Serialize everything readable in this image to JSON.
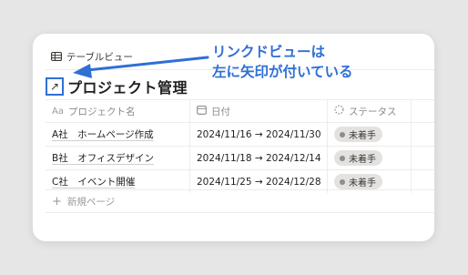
{
  "view": {
    "tab_label": "テーブルビュー",
    "link_icon": "↗",
    "title": "プロジェクト管理"
  },
  "columns": [
    {
      "icon": "Aa",
      "label": "プロジェクト名"
    },
    {
      "icon": "calendar-icon",
      "label": "日付"
    },
    {
      "icon": "status-icon",
      "label": "ステータス"
    }
  ],
  "rows": [
    {
      "name": "A社　ホームページ作成",
      "date": "2024/11/16 → 2024/11/30",
      "status": "未着手"
    },
    {
      "name": "B社　オフィスデザイン",
      "date": "2024/11/18 → 2024/12/14",
      "status": "未着手"
    },
    {
      "name": "C社　イベント開催",
      "date": "2024/11/25 → 2024/12/28",
      "status": "未着手"
    }
  ],
  "new_page": {
    "label": "新規ページ",
    "icon": "+"
  },
  "annotation": {
    "line1": "リンクドビューは",
    "line2": "左に矢印が付いている",
    "color": "#2f6fd6"
  }
}
